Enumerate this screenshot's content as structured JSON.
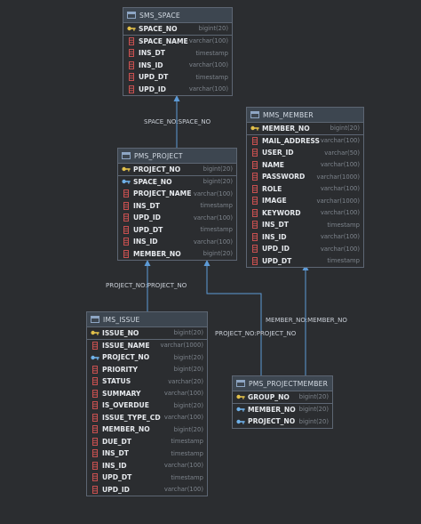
{
  "tables": {
    "sms_space": {
      "name": "SMS_SPACE",
      "columns": [
        {
          "name": "SPACE_NO",
          "type": "bigint(20)",
          "icon": "primary-key-icon"
        },
        {
          "name": "SPACE_NAME",
          "type": "varchar(100)",
          "icon": "column-icon"
        },
        {
          "name": "INS_DT",
          "type": "timestamp",
          "icon": "column-icon"
        },
        {
          "name": "INS_ID",
          "type": "varchar(100)",
          "icon": "column-icon"
        },
        {
          "name": "UPD_DT",
          "type": "timestamp",
          "icon": "column-icon"
        },
        {
          "name": "UPD_ID",
          "type": "varchar(100)",
          "icon": "column-icon"
        }
      ]
    },
    "pms_project": {
      "name": "PMS_PROJECT",
      "columns": [
        {
          "name": "PROJECT_NO",
          "type": "bigint(20)",
          "icon": "primary-key-icon"
        },
        {
          "name": "SPACE_NO",
          "type": "bigint(20)",
          "icon": "foreign-key-icon"
        },
        {
          "name": "PROJECT_NAME",
          "type": "varchar(100)",
          "icon": "column-icon"
        },
        {
          "name": "INS_DT",
          "type": "timestamp",
          "icon": "column-icon"
        },
        {
          "name": "UPD_ID",
          "type": "varchar(100)",
          "icon": "column-icon"
        },
        {
          "name": "UPD_DT",
          "type": "timestamp",
          "icon": "column-icon"
        },
        {
          "name": "INS_ID",
          "type": "varchar(100)",
          "icon": "column-icon"
        },
        {
          "name": "MEMBER_NO",
          "type": "bigint(20)",
          "icon": "column-icon"
        }
      ]
    },
    "mms_member": {
      "name": "MMS_MEMBER",
      "columns": [
        {
          "name": "MEMBER_NO",
          "type": "bigint(20)",
          "icon": "primary-key-icon"
        },
        {
          "name": "MAIL_ADDRESS",
          "type": "varchar(100)",
          "icon": "column-icon"
        },
        {
          "name": "USER_ID",
          "type": "varchar(50)",
          "icon": "column-icon"
        },
        {
          "name": "NAME",
          "type": "varchar(100)",
          "icon": "column-icon"
        },
        {
          "name": "PASSWORD",
          "type": "varchar(1000)",
          "icon": "column-icon"
        },
        {
          "name": "ROLE",
          "type": "varchar(100)",
          "icon": "column-icon"
        },
        {
          "name": "IMAGE",
          "type": "varchar(1000)",
          "icon": "column-icon"
        },
        {
          "name": "KEYWORD",
          "type": "varchar(100)",
          "icon": "column-icon"
        },
        {
          "name": "INS_DT",
          "type": "timestamp",
          "icon": "column-icon"
        },
        {
          "name": "INS_ID",
          "type": "varchar(100)",
          "icon": "column-icon"
        },
        {
          "name": "UPD_ID",
          "type": "varchar(100)",
          "icon": "column-icon"
        },
        {
          "name": "UPD_DT",
          "type": "timestamp",
          "icon": "column-icon"
        }
      ]
    },
    "ims_issue": {
      "name": "IMS_ISSUE",
      "columns": [
        {
          "name": "ISSUE_NO",
          "type": "bigint(20)",
          "icon": "primary-key-icon"
        },
        {
          "name": "ISSUE_NAME",
          "type": "varchar(1000)",
          "icon": "column-icon"
        },
        {
          "name": "PROJECT_NO",
          "type": "bigint(20)",
          "icon": "foreign-key-icon"
        },
        {
          "name": "PRIORITY",
          "type": "bigint(20)",
          "icon": "column-icon"
        },
        {
          "name": "STATUS",
          "type": "varchar(20)",
          "icon": "column-icon"
        },
        {
          "name": "SUMMARY",
          "type": "varchar(100)",
          "icon": "column-icon"
        },
        {
          "name": "IS_OVERDUE",
          "type": "bigint(20)",
          "icon": "column-icon"
        },
        {
          "name": "ISSUE_TYPE_CD",
          "type": "varchar(100)",
          "icon": "column-icon"
        },
        {
          "name": "MEMBER_NO",
          "type": "bigint(20)",
          "icon": "column-icon"
        },
        {
          "name": "DUE_DT",
          "type": "timestamp",
          "icon": "column-icon"
        },
        {
          "name": "INS_DT",
          "type": "timestamp",
          "icon": "column-icon"
        },
        {
          "name": "INS_ID",
          "type": "varchar(100)",
          "icon": "column-icon"
        },
        {
          "name": "UPD_DT",
          "type": "timestamp",
          "icon": "column-icon"
        },
        {
          "name": "UPD_ID",
          "type": "varchar(100)",
          "icon": "column-icon"
        }
      ]
    },
    "pms_projectmember": {
      "name": "PMS_PROJECTMEMBER",
      "columns": [
        {
          "name": "GROUP_NO",
          "type": "bigint(20)",
          "icon": "primary-key-icon"
        },
        {
          "name": "MEMBER_NO",
          "type": "bigint(20)",
          "icon": "foreign-key-icon"
        },
        {
          "name": "PROJECT_NO",
          "type": "bigint(20)",
          "icon": "foreign-key-icon"
        }
      ]
    }
  },
  "relations": {
    "space_project": "SPACE_NO:SPACE_NO",
    "project_issue": "PROJECT_NO:PROJECT_NO",
    "project_projectmember": "PROJECT_NO:PROJECT_NO",
    "member_projectmember": "MEMBER_NO:MEMBER_NO"
  },
  "colors": {
    "background": "#2b2d30",
    "border": "#5d6673",
    "header": "#3d4650",
    "connector": "#5d9ad6",
    "primary_key": "#e2c04a",
    "foreign_key": "#6fb1e8",
    "column": "#c75050"
  }
}
